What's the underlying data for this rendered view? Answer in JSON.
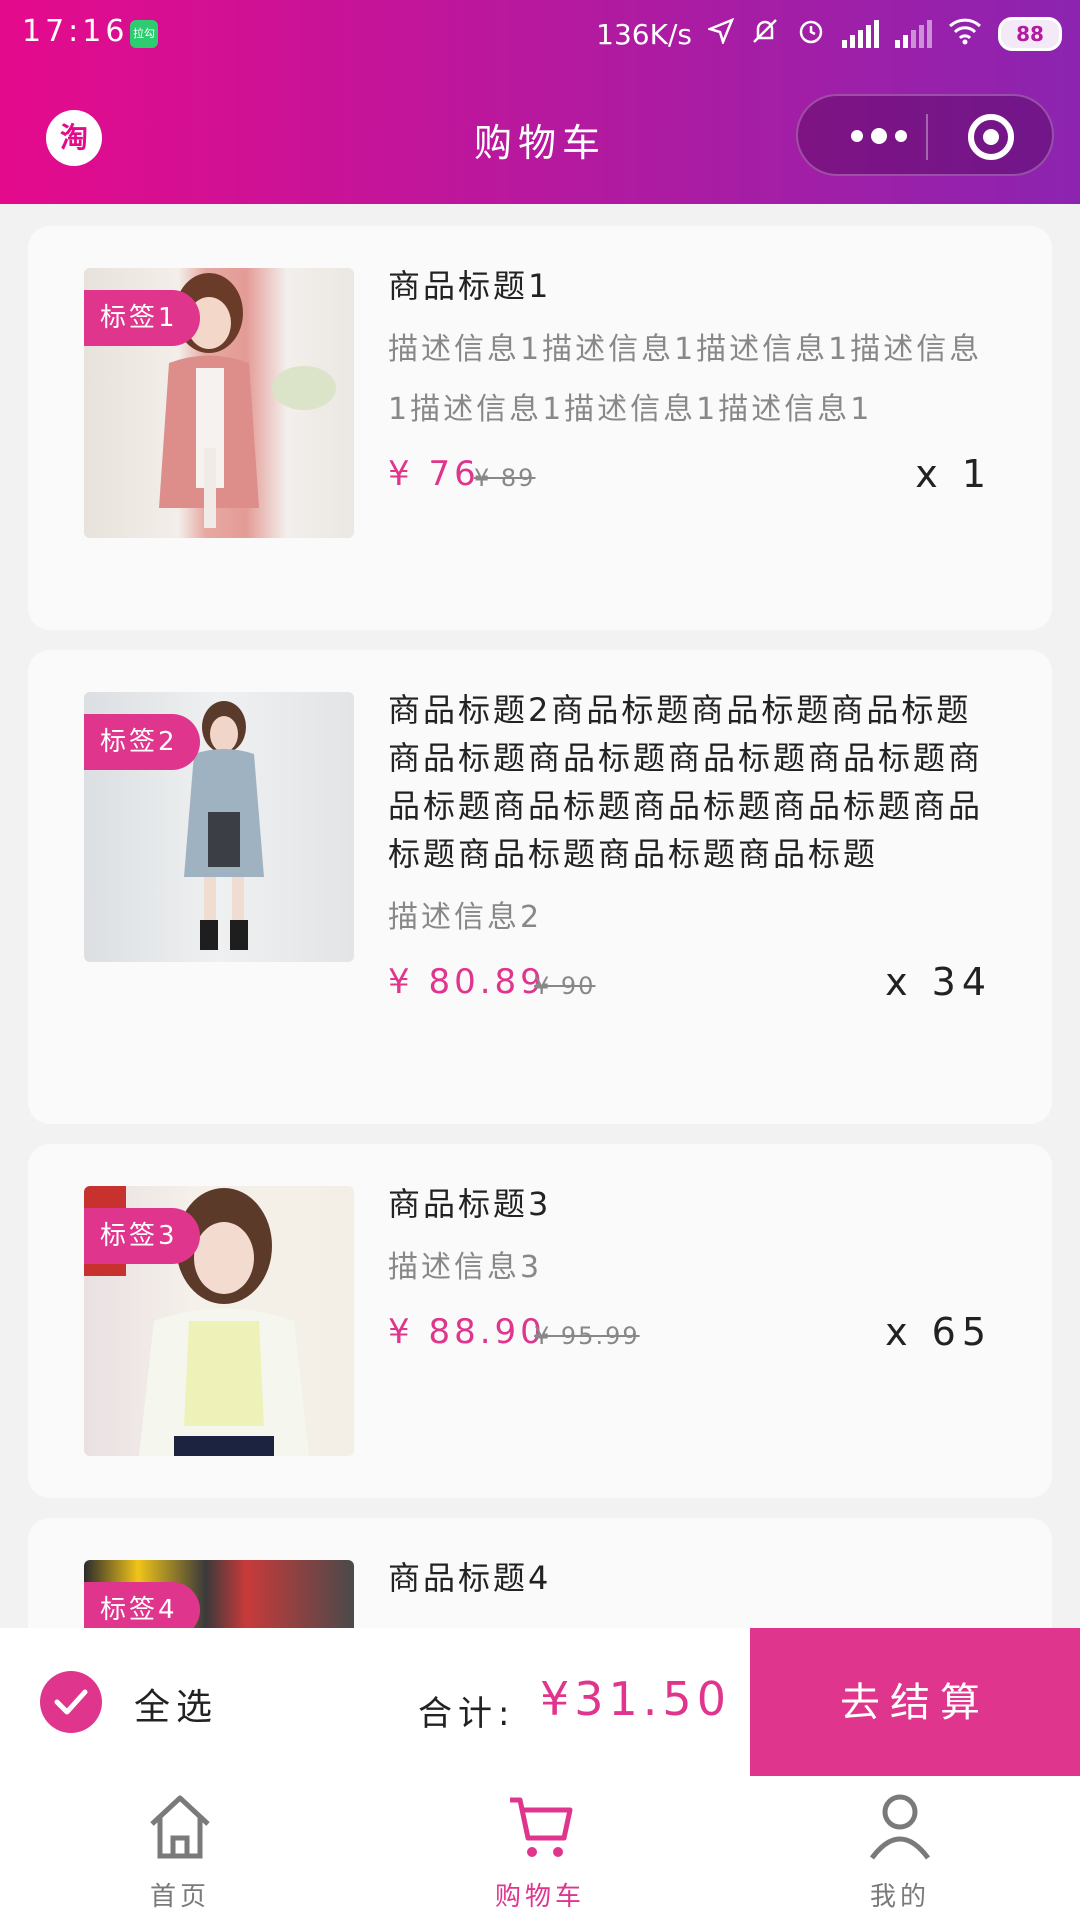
{
  "status_bar": {
    "time": "17:16",
    "app_icon": "拉勾",
    "net_speed": "136K/s",
    "battery": "88",
    "icons": [
      "location-icon",
      "mute-icon",
      "alarm-icon",
      "signal-icon",
      "signal-icon",
      "wifi-icon",
      "battery-icon"
    ]
  },
  "nav": {
    "logo_text": "淘",
    "title": "购物车",
    "menu_icon": "more-dots-icon",
    "close_icon": "target-icon"
  },
  "items": [
    {
      "tag": "标签1",
      "title": "商品标题1",
      "desc": "描述信息1描述信息1描述信息1描述信息1描述信息1描述信息1描述信息1",
      "price": "¥ 76",
      "orig_price": "¥ 89",
      "qty": "x 1"
    },
    {
      "tag": "标签2",
      "title": "商品标题2商品标题商品标题商品标题商品标题商品标题商品标题商品标题商品标题商品标题商品标题商品标题商品标题商品标题商品标题商品标题",
      "desc": "描述信息2",
      "price": "¥ 80.89",
      "orig_price": "¥ 90",
      "qty": "x 34"
    },
    {
      "tag": "标签3",
      "title": "商品标题3",
      "desc": "描述信息3",
      "price": "¥ 88.90",
      "orig_price": "¥ 95.99",
      "qty": "x 65"
    },
    {
      "tag": "标签4",
      "title": "商品标题4",
      "desc": "",
      "price": "",
      "orig_price": "",
      "qty": ""
    }
  ],
  "checkout": {
    "select_all": "全选",
    "total_label": "合计:",
    "total_value": "¥31.50",
    "button": "去结算"
  },
  "tabs": [
    {
      "label": "首页",
      "icon": "home-icon"
    },
    {
      "label": "购物车",
      "icon": "cart-icon"
    },
    {
      "label": "我的",
      "icon": "user-icon"
    }
  ],
  "colors": {
    "accent": "#e0358d",
    "header_start": "#e50a8c",
    "header_end": "#8c24b0"
  }
}
